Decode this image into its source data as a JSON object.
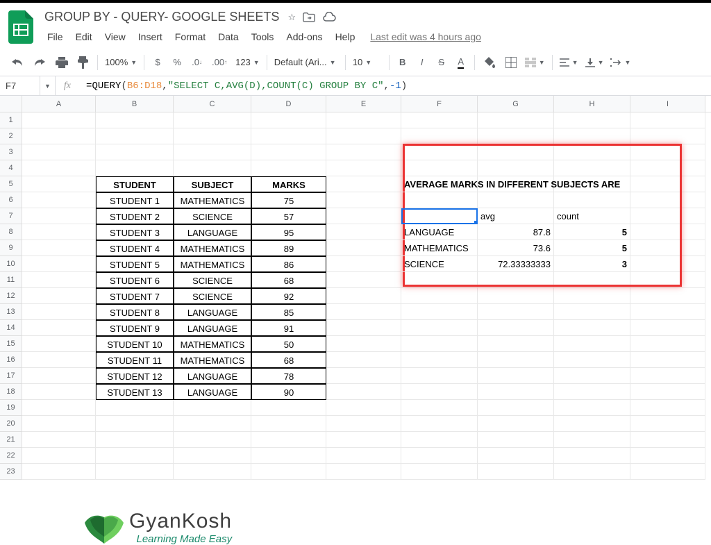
{
  "title": "GROUP BY - QUERY- GOOGLE SHEETS",
  "menus": [
    "File",
    "Edit",
    "View",
    "Insert",
    "Format",
    "Data",
    "Tools",
    "Add-ons",
    "Help"
  ],
  "last_edit": "Last edit was 4 hours ago",
  "toolbar": {
    "zoom": "100%",
    "font": "Default (Ari...",
    "size": "10"
  },
  "name_box": "F7",
  "formula": {
    "fn": "QUERY",
    "range": "B6:D18",
    "string": "\"SELECT C,AVG(D),COUNT(C) GROUP BY C\"",
    "num": "-1"
  },
  "columns": [
    "A",
    "B",
    "C",
    "D",
    "E",
    "F",
    "G",
    "H",
    "I"
  ],
  "rows": [
    "1",
    "2",
    "3",
    "4",
    "5",
    "6",
    "7",
    "8",
    "9",
    "10",
    "11",
    "12",
    "13",
    "14",
    "15",
    "16",
    "17",
    "18",
    "19",
    "20",
    "21",
    "22",
    "23"
  ],
  "table": {
    "headers": [
      "STUDENT",
      "SUBJECT",
      "MARKS"
    ],
    "data": [
      [
        "STUDENT 1",
        "MATHEMATICS",
        "75"
      ],
      [
        "STUDENT 2",
        "SCIENCE",
        "57"
      ],
      [
        "STUDENT 3",
        "LANGUAGE",
        "95"
      ],
      [
        "STUDENT 4",
        "MATHEMATICS",
        "89"
      ],
      [
        "STUDENT 5",
        "MATHEMATICS",
        "86"
      ],
      [
        "STUDENT 6",
        "SCIENCE",
        "68"
      ],
      [
        "STUDENT 7",
        "SCIENCE",
        "92"
      ],
      [
        "STUDENT 8",
        "LANGUAGE",
        "85"
      ],
      [
        "STUDENT 9",
        "LANGUAGE",
        "91"
      ],
      [
        "STUDENT 10",
        "MATHEMATICS",
        "50"
      ],
      [
        "STUDENT 11",
        "MATHEMATICS",
        "68"
      ],
      [
        "STUDENT 12",
        "LANGUAGE",
        "78"
      ],
      [
        "STUDENT 13",
        "LANGUAGE",
        "90"
      ]
    ]
  },
  "result": {
    "title": "AVERAGE MARKS IN DIFFERENT SUBJECTS ARE",
    "headers": [
      "",
      "avg",
      "count"
    ],
    "rows": [
      [
        "LANGUAGE",
        "87.8",
        "5"
      ],
      [
        "MATHEMATICS",
        "73.6",
        "5"
      ],
      [
        "SCIENCE",
        "72.33333333",
        "3"
      ]
    ]
  },
  "watermark": {
    "name": "GyanKosh",
    "tag": "Learning Made Easy"
  }
}
